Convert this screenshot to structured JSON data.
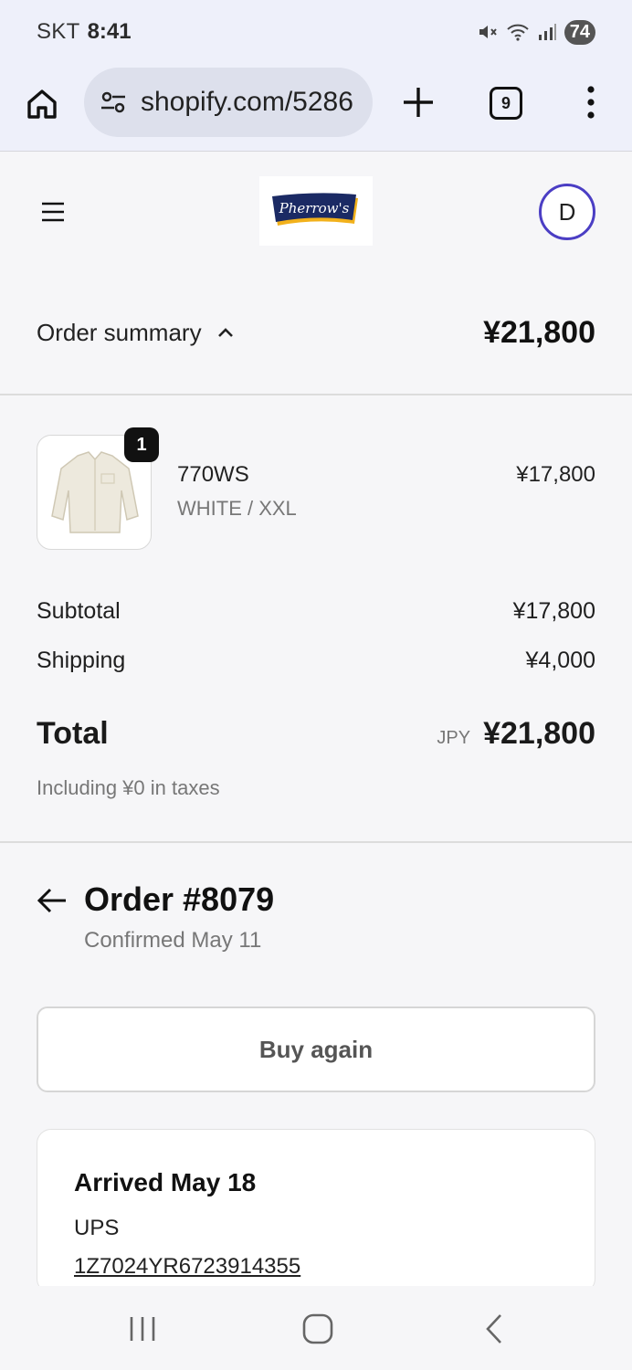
{
  "status_bar": {
    "carrier": "SKT",
    "time": "8:41",
    "battery": "74"
  },
  "browser": {
    "url": "shopify.com/5286",
    "tab_count": "9"
  },
  "shop": {
    "logo_text": "Pherrow's",
    "avatar_initial": "D"
  },
  "summary": {
    "label": "Order summary",
    "total": "¥21,800"
  },
  "product": {
    "quantity": "1",
    "name": "770WS",
    "variant": "WHITE / XXL",
    "price": "¥17,800"
  },
  "costs": {
    "subtotal_label": "Subtotal",
    "subtotal": "¥17,800",
    "shipping_label": "Shipping",
    "shipping": "¥4,000",
    "total_label": "Total",
    "currency": "JPY",
    "total": "¥21,800",
    "taxes_note": "Including ¥0 in taxes"
  },
  "order": {
    "title": "Order #8079",
    "status": "Confirmed May 11"
  },
  "buy_again_label": "Buy again",
  "delivery": {
    "status": "Arrived May 18",
    "carrier": "UPS",
    "tracking": "1Z7024YR6723914355"
  },
  "colors": {
    "accent": "#4b3ec4",
    "logo_navy": "#1b2a64",
    "logo_gold": "#f2b11b"
  }
}
